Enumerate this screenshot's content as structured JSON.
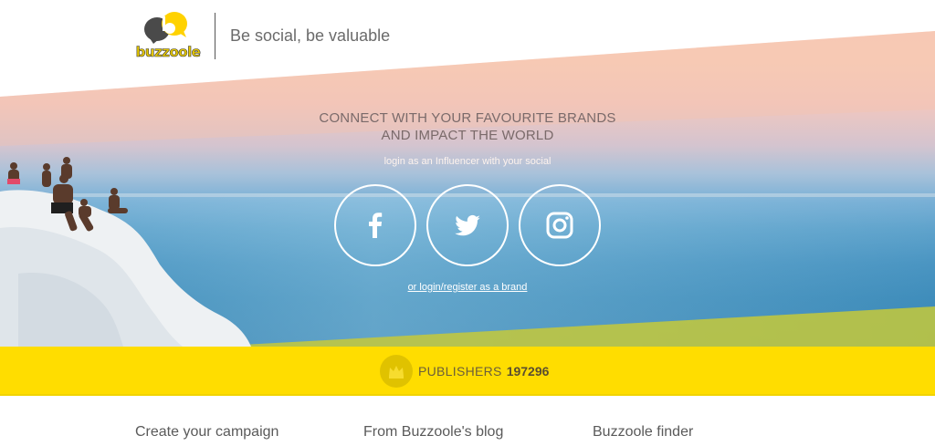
{
  "header": {
    "logo_text": "buzzoole",
    "tagline": "Be social, be valuable"
  },
  "hero": {
    "headline_line1": "CONNECT WITH YOUR FAVOURITE BRANDS",
    "headline_line2": "AND IMPACT THE WORLD",
    "subline": "login as an Influencer with your social",
    "social_buttons": [
      {
        "icon": "facebook-icon"
      },
      {
        "icon": "twitter-icon"
      },
      {
        "icon": "instagram-icon"
      }
    ],
    "brand_link": "or login/register as a brand"
  },
  "publishers": {
    "icon": "crown-icon",
    "label": "PUBLISHERS",
    "count": "197296"
  },
  "footer": {
    "links": [
      "Create your campaign",
      "From Buzzoole's blog",
      "Buzzoole finder"
    ]
  },
  "colors": {
    "accent_yellow": "#ffdd00",
    "text_gray": "#6b6b6b"
  }
}
